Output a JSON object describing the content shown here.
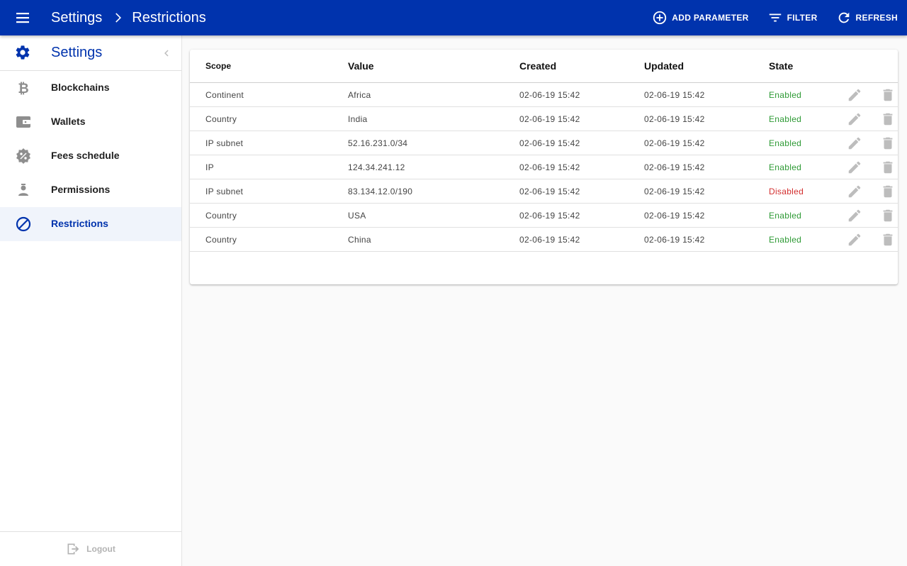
{
  "appbar": {
    "menu_icon": "menu-icon",
    "breadcrumb": [
      "Settings",
      "Restrictions"
    ],
    "actions": [
      {
        "label": "ADD PARAMETER",
        "icon": "add-circle-icon"
      },
      {
        "label": "FILTER",
        "icon": "filter-icon"
      },
      {
        "label": "REFRESH",
        "icon": "refresh-icon"
      }
    ],
    "background": "#0033ad"
  },
  "sidebar": {
    "title": "Settings",
    "items": [
      {
        "label": "Blockchains",
        "icon": "bitcoin-icon"
      },
      {
        "label": "Wallets",
        "icon": "wallet-icon"
      },
      {
        "label": "Fees schedule",
        "icon": "percent-badge-icon"
      },
      {
        "label": "Permissions",
        "icon": "person-badge-icon"
      },
      {
        "label": "Restrictions",
        "icon": "block-icon",
        "active": true
      }
    ],
    "logout_label": "Logout"
  },
  "table": {
    "columns": [
      "Scope",
      "Value",
      "Created",
      "Updated",
      "State"
    ],
    "rows": [
      {
        "scope": "Continent",
        "value": "Africa",
        "created": "02-06-19 15:42",
        "updated": "02-06-19 15:42",
        "state": "Enabled"
      },
      {
        "scope": "Country",
        "value": "India",
        "created": "02-06-19 15:42",
        "updated": "02-06-19 15:42",
        "state": "Enabled"
      },
      {
        "scope": "IP subnet",
        "value": "52.16.231.0/34",
        "created": "02-06-19 15:42",
        "updated": "02-06-19 15:42",
        "state": "Enabled"
      },
      {
        "scope": "IP",
        "value": "124.34.241.12",
        "created": "02-06-19 15:42",
        "updated": "02-06-19 15:42",
        "state": "Enabled"
      },
      {
        "scope": "IP subnet",
        "value": "83.134.12.0/190",
        "created": "02-06-19 15:42",
        "updated": "02-06-19 15:42",
        "state": "Disabled"
      },
      {
        "scope": "Country",
        "value": "USA",
        "created": "02-06-19 15:42",
        "updated": "02-06-19 15:42",
        "state": "Enabled"
      },
      {
        "scope": "Country",
        "value": "China",
        "created": "02-06-19 15:42",
        "updated": "02-06-19 15:42",
        "state": "Enabled"
      }
    ],
    "colors": {
      "enabled": "#2e9a35",
      "disabled": "#d32f2f"
    }
  }
}
